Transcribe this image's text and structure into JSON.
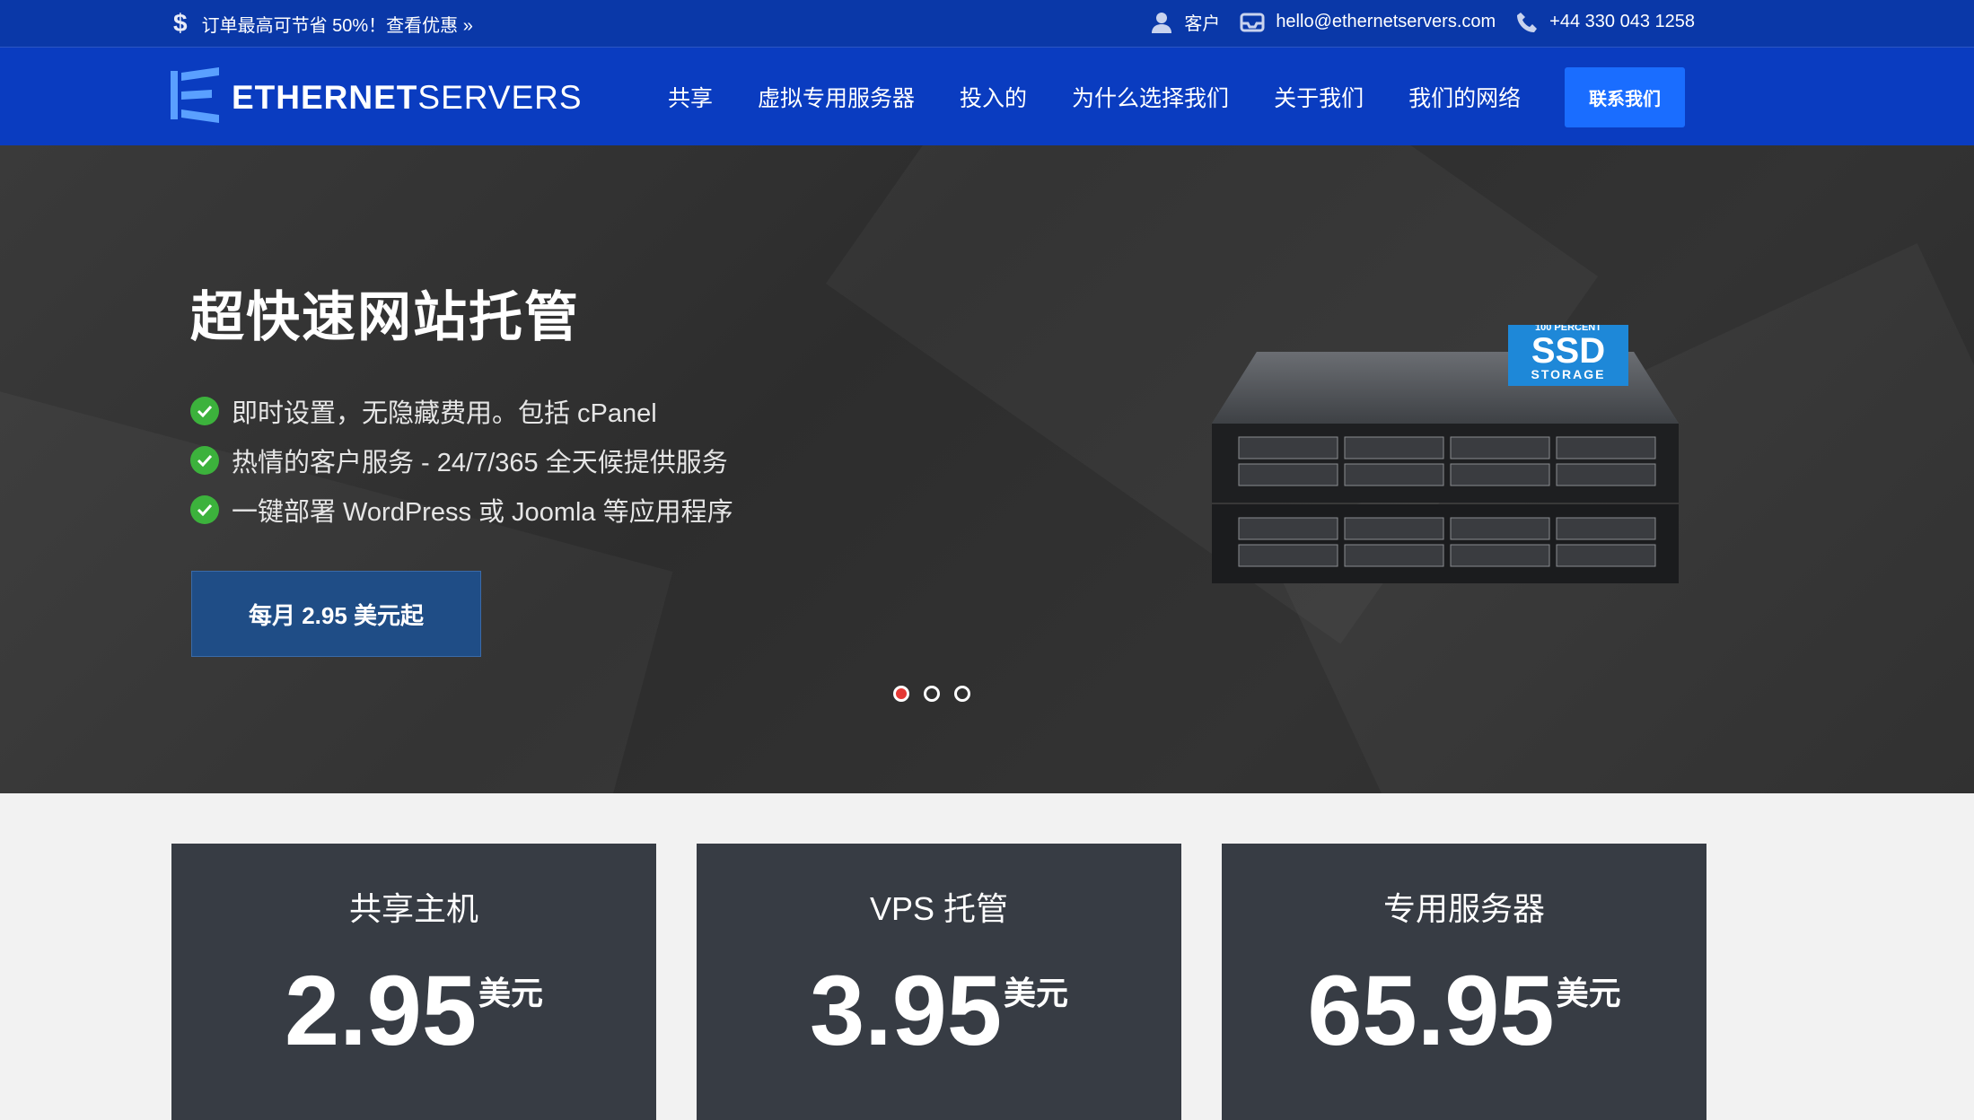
{
  "topbar": {
    "promo": "订单最高可节省 50%！查看优惠 »",
    "client_label": "客户",
    "email": "hello@ethernetservers.com",
    "phone": "+44 330 043 1258"
  },
  "nav": {
    "logo_bold": "ETHERNET",
    "logo_light": "SERVERS",
    "items": [
      "共享",
      "虚拟专用服务器",
      "投入的",
      "为什么选择我们",
      "关于我们",
      "我们的网络"
    ],
    "contact_label": "联系我们"
  },
  "hero": {
    "title": "超快速网站托管",
    "features": [
      "即时设置，无隐藏费用。包括 cPanel",
      "热情的客户服务 - 24/7/365 全天候提供服务",
      "一键部署 WordPress 或 Joomla 等应用程序"
    ],
    "cta_label": "每月 2.95 美元起",
    "badge_top": "100 PERCENT",
    "badge_main": "SSD",
    "badge_bottom": "STORAGE",
    "slides_total": 3,
    "active_slide": 1
  },
  "plans": [
    {
      "title": "共享主机",
      "price": "2.95",
      "currency": "美元"
    },
    {
      "title": "VPS 托管",
      "price": "3.95",
      "currency": "美元"
    },
    {
      "title": "专用服务器",
      "price": "65.95",
      "currency": "美元"
    }
  ],
  "colors": {
    "topbar": "#0a38a8",
    "nav": "#0a3cc0",
    "accent": "#1a6dff",
    "check": "#3cb23c",
    "card": "#373c44"
  }
}
